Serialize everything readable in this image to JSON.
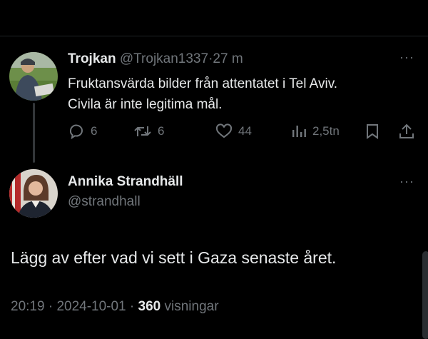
{
  "reply_tweet": {
    "display_name": "Trojkan",
    "handle": "@Trojkan1337",
    "separator": "·",
    "time_ago": "27 m",
    "text_line1": "Fruktansvärda bilder från attentatet i Tel Aviv.",
    "text_line2": "Civila är inte legitima mål.",
    "more_label": "···",
    "actions": {
      "replies": "6",
      "retweets": "6",
      "likes": "44",
      "views": "2,5tn"
    },
    "icons": [
      "reply-icon",
      "retweet-icon",
      "like-icon",
      "views-icon",
      "bookmark-icon",
      "share-icon"
    ]
  },
  "main_tweet": {
    "display_name": "Annika Strandhäll",
    "handle": "@strandhall",
    "more_label": "···",
    "text": "Lägg av efter vad vi sett i Gaza senaste året.",
    "meta": {
      "time": "20:19",
      "sep1": " · ",
      "date": "2024-10-01",
      "sep2": " · ",
      "views_count": "360",
      "views_label": " visningar"
    }
  },
  "colors": {
    "background": "#000000",
    "text": "#e7e9ea",
    "muted": "#71767b",
    "thread_line": "#333639"
  }
}
